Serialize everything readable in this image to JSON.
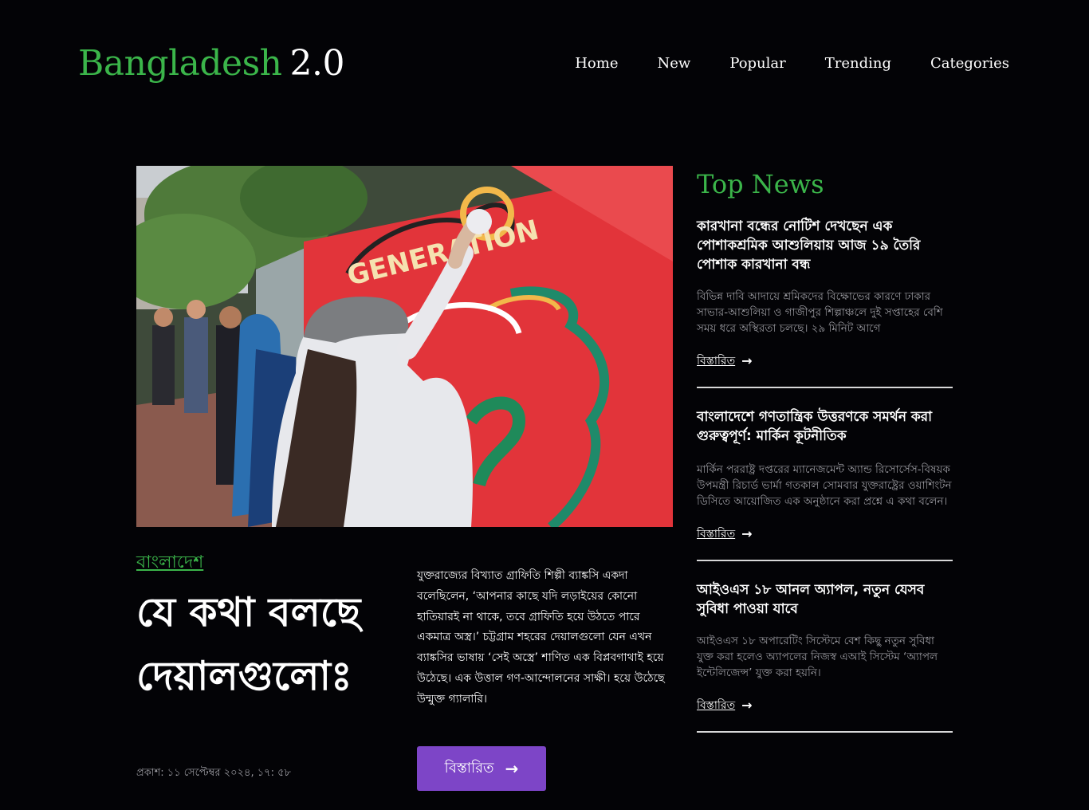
{
  "header": {
    "logo_primary": "Bangladesh",
    "logo_secondary": "2.0",
    "nav": [
      "Home",
      "New",
      "Popular",
      "Trending",
      "Categories"
    ]
  },
  "featured": {
    "category": "বাংলাদেশ",
    "headline": "যে কথা বলছে দেয়ালগুলোঃ",
    "published": "প্রকাশ: ১১ সেপ্টেম্বর ২০২৪, ১৭: ৫৮",
    "excerpt": "যুক্তরাজ্যের বিখ্যাত গ্রাফিতি শিল্পী ব্যাঙ্কসি একদা বলেছিলেন, ‘আপনার কাছে যদি লড়াইয়ের কোনো হাতিয়ারই না থাকে, তবে গ্রাফিতি হয়ে উঠতে পারে একমাত্র অস্ত্র।’ চট্টগ্রাম শহরের দেয়ালগুলো যেন এখন ব্যাঙ্কসির ভাষায় ‘সেই অস্ত্রে’ শাণিত এক বিপ্লবগাথাই হয়ে উঠেছে। এক উত্তাল গণ-আন্দোলনের সাক্ষী। হয়ে উঠেছে উন্মুক্ত গ্যালারি।",
    "button_label": "বিস্তারিত",
    "image_mural_text": "GENERATION"
  },
  "sidebar": {
    "title": "Top News",
    "items": [
      {
        "title": "কারখানা বন্ধের নোটিশ দেখছেন এক পোশাকশ্রমিক আশুলিয়ায় আজ ১৯ তৈরি পোশাক কারখানা বন্ধ",
        "summary": "বিভিন্ন দাবি আদায়ে শ্রমিকদের বিক্ষোভের কারণে ঢাকার সাভার-আশুলিয়া ও গাজীপুর শিল্পাঞ্চলে দুই সপ্তাহের বেশি সময় ধরে অস্থিরতা চলছে। ২৯ মিনিট আগে",
        "link": "বিস্তারিত"
      },
      {
        "title": "বাংলাদেশে গণতান্ত্রিক উত্তরণকে সমর্থন করা গুরুত্বপূর্ণ: মার্কিন কূটনীতিক",
        "summary": "মার্কিন পররাষ্ট্র দপ্তরের ম্যানেজমেন্ট অ্যান্ড রিসোর্সেস-বিষয়ক উপমন্ত্রী রিচার্ড ভার্মা গতকাল সোমবার যুক্তরাষ্ট্রের ওয়াশিংটন ডিসিতে আয়োজিত এক অনুষ্ঠানে করা প্রশ্নে এ কথা বলেন।",
        "link": "বিস্তারিত"
      },
      {
        "title": "আইওএস ১৮ আনল অ্যাপল, নতুন যেসব সুবিধা পাওয়া যাবে",
        "summary": "আইওএস ১৮ অপারেটিং সিস্টেমে বেশ কিছু নতুন সুবিধা যুক্ত করা হলেও অ্যাপলের নিজস্ব এআই সিস্টেম ‘অ্যাপল ইন্টেলিজেন্স’ যুক্ত করা হয়নি।",
        "link": "বিস্তারিত"
      }
    ]
  },
  "colors": {
    "background": "#030306",
    "accent_green": "#3bb54a",
    "button_purple": "#7d45c7",
    "muted_text": "#9a9aa0"
  },
  "icons": [
    "arrow-right-icon"
  ]
}
